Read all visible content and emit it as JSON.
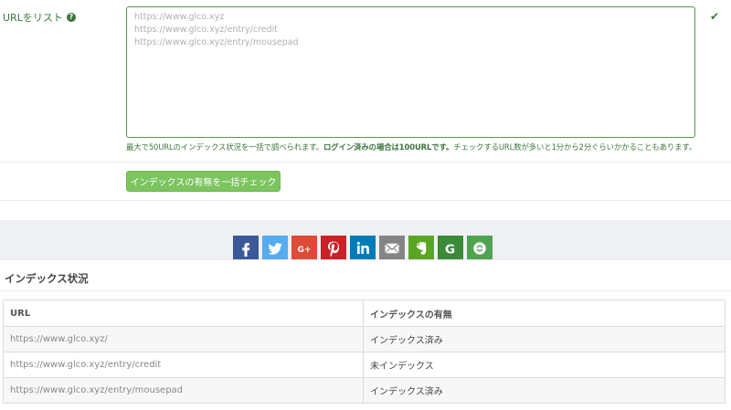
{
  "form": {
    "label": "URLをリスト",
    "help_icon": "question-circle-icon",
    "textarea_value": "https://www.glco.xyz\nhttps://www.glco.xyz/entry/credit\nhttps://www.glco.xyz/entry/mousepad",
    "valid_icon": "check-icon",
    "help_text_1": "最大で50URLのインデックス状況を一括で調べられます。",
    "help_text_bold": "ログイン済みの場合は100URLです。",
    "help_text_2": "チェックするURL数が多いと1分から2分ぐらいかかることもあります。",
    "check_button": "インデックスの有無を一括チェック"
  },
  "share": {
    "buttons": [
      {
        "name": "facebook",
        "icon": "facebook-icon",
        "color": "#3b5998"
      },
      {
        "name": "twitter",
        "icon": "twitter-icon",
        "color": "#55acee"
      },
      {
        "name": "google-plus",
        "icon": "google-plus-icon",
        "color": "#dd4b39"
      },
      {
        "name": "pinterest",
        "icon": "pinterest-icon",
        "color": "#cb2027"
      },
      {
        "name": "linkedin",
        "icon": "linkedin-icon",
        "color": "#007bb5"
      },
      {
        "name": "email",
        "icon": "envelope-icon",
        "color": "#848484"
      },
      {
        "name": "evernote",
        "icon": "evernote-icon",
        "color": "#5ba525"
      },
      {
        "name": "google",
        "icon": "google-icon",
        "color": "#3a8a3a"
      },
      {
        "name": "sharethis",
        "icon": "sharethis-icon",
        "color": "#4fa34f"
      }
    ]
  },
  "results": {
    "title": "インデックス状況",
    "columns": [
      "URL",
      "インデックスの有無"
    ],
    "rows": [
      {
        "url": "https://www.glco.xyz/",
        "status": "インデックス済み"
      },
      {
        "url": "https://www.glco.xyz/entry/credit",
        "status": "未インデックス"
      },
      {
        "url": "https://www.glco.xyz/entry/mousepad",
        "status": "インデックス済み"
      }
    ]
  }
}
